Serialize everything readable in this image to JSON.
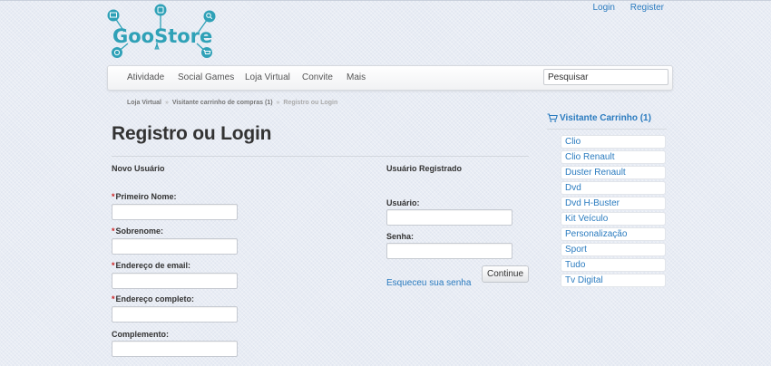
{
  "brand": {
    "logo_text": "GooStore"
  },
  "top_links": {
    "login": "Login",
    "register": "Register"
  },
  "nav": {
    "items": [
      {
        "label": "Atividade"
      },
      {
        "label": "Social Games"
      },
      {
        "label": "Loja Virtual"
      },
      {
        "label": "Convite"
      },
      {
        "label": "Mais"
      }
    ],
    "search_placeholder": "Pesquisar"
  },
  "breadcrumb": {
    "items": [
      "Loja Virtual",
      "Visitante carrinho de compras (1)"
    ],
    "separator": "»",
    "current": "Registro ou Login"
  },
  "page": {
    "title": "Registro ou Login"
  },
  "new_user": {
    "heading": "Novo Usuário",
    "fields": [
      {
        "label": "Primeiro Nome:",
        "required": true,
        "value": ""
      },
      {
        "label": "Sobrenome:",
        "required": true,
        "value": ""
      },
      {
        "label": "Endereço de email:",
        "required": true,
        "value": ""
      },
      {
        "label": "Endereço completo:",
        "required": true,
        "value": ""
      },
      {
        "label": "Complemento:",
        "required": false,
        "value": ""
      }
    ],
    "required_marker": "*"
  },
  "registered_user": {
    "heading": "Usuário Registrado",
    "fields": [
      {
        "label": "Usuário:",
        "value": ""
      },
      {
        "label": "Senha:",
        "value": ""
      }
    ],
    "continue_label": "Continue",
    "forgot_label": "Esqueceu sua senha"
  },
  "cart": {
    "title": "Visitante Carrinho (1)",
    "categories": [
      "Clio",
      "Clio Renault",
      "Duster Renault",
      "Dvd",
      "Dvd H-Buster",
      "Kit Veículo",
      "Personalização",
      "Sport",
      "Tudo",
      "Tv Digital"
    ]
  },
  "colors": {
    "link": "#2a7bbf",
    "logo": "#2fa1b7",
    "required": "#cc2222"
  }
}
